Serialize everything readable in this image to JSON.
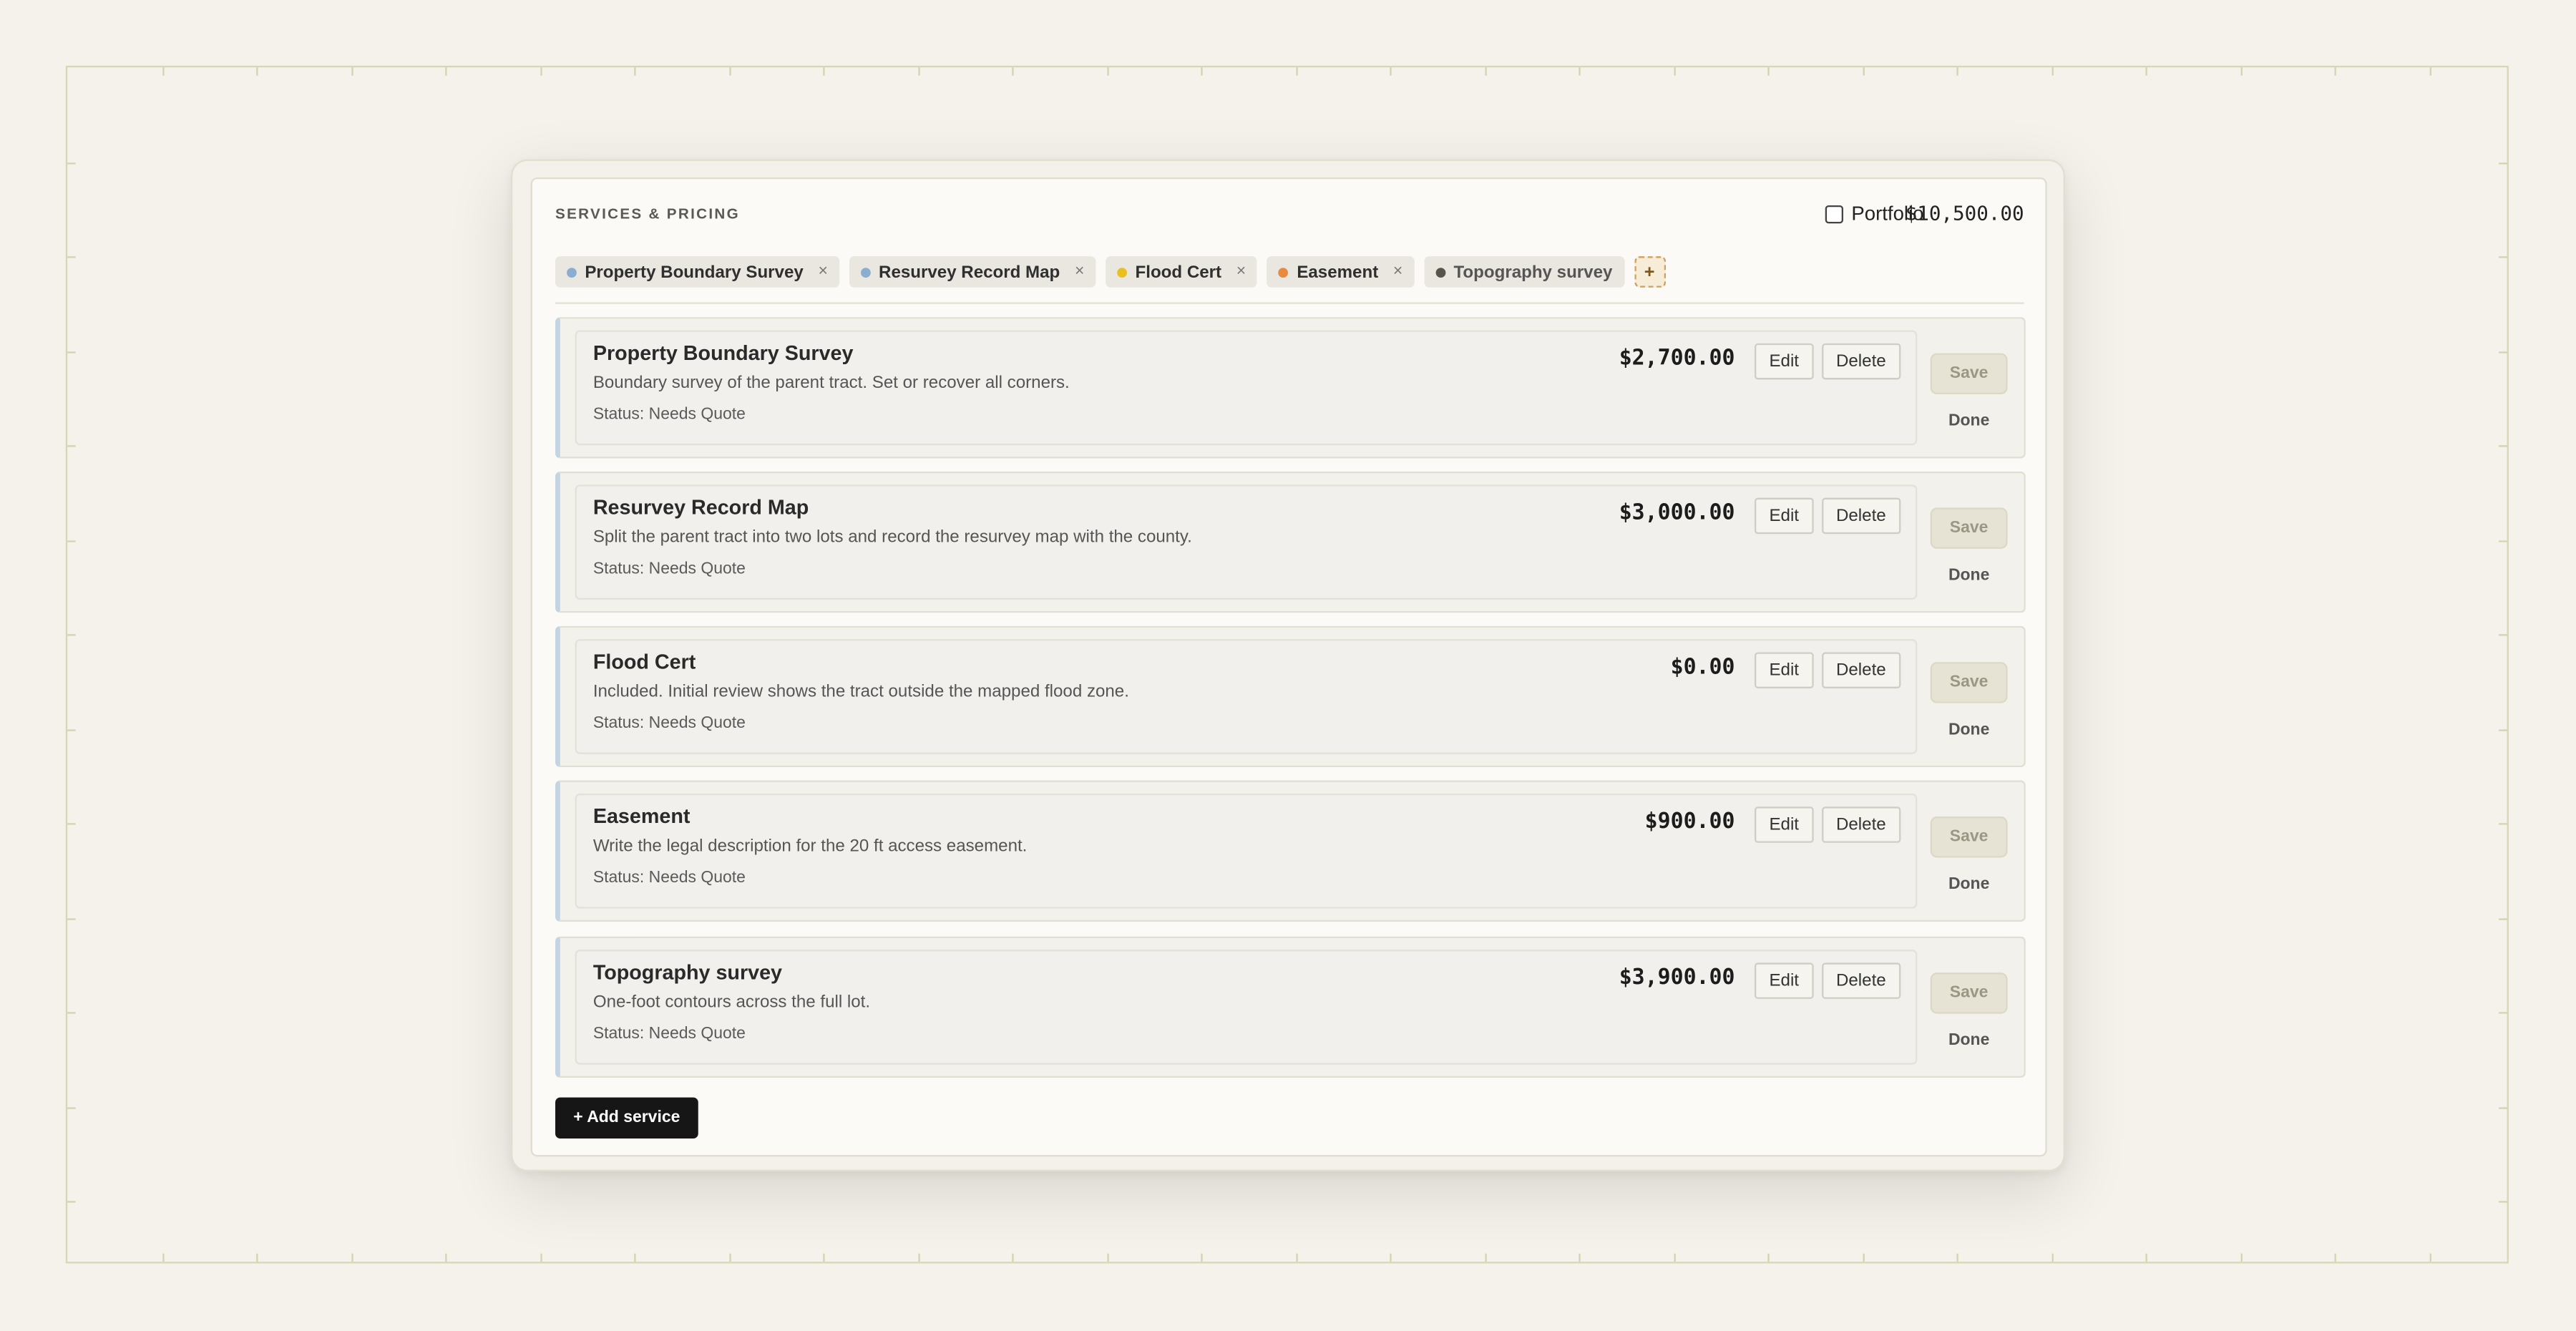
{
  "header": {
    "section_title": "SERVICES & PRICING",
    "portfolio_label": "Portfolio",
    "total": "$10,500.00"
  },
  "tags": [
    {
      "label": "Property Boundary Survey",
      "color": "#8aaed0",
      "removable": true
    },
    {
      "label": "Resurvey Record Map",
      "color": "#8aaed0",
      "removable": true
    },
    {
      "label": "Flood Cert",
      "color": "#e8c020",
      "removable": true
    },
    {
      "label": "Easement",
      "color": "#e88a40",
      "removable": true
    },
    {
      "label": "Topography survey",
      "color": "#55554a",
      "removable": false
    }
  ],
  "add_tag_label": "+",
  "remove_glyph": "×",
  "services": [
    {
      "name": "Property Boundary Survey",
      "description": "Boundary survey of the parent tract. Set or recover all corners.",
      "status": "Status: Needs Quote",
      "price": "$2,700.00"
    },
    {
      "name": "Resurvey Record Map",
      "description": "Split the parent tract into two lots and record the resurvey map with the county.",
      "status": "Status: Needs Quote",
      "price": "$3,000.00"
    },
    {
      "name": "Flood Cert",
      "description": "Included. Initial review shows the tract outside the mapped flood zone.",
      "status": "Status: Needs Quote",
      "price": "$0.00"
    },
    {
      "name": "Easement",
      "description": "Write the legal description for the 20 ft access easement.",
      "status": "Status: Needs Quote",
      "price": "$900.00"
    },
    {
      "name": "Topography survey",
      "description": "One-foot contours across the full lot.",
      "status": "Status: Needs Quote",
      "price": "$3,900.00"
    }
  ],
  "buttons": {
    "edit": "Edit",
    "delete": "Delete",
    "save": "Save",
    "done": "Done",
    "add_service": "+ Add service"
  }
}
